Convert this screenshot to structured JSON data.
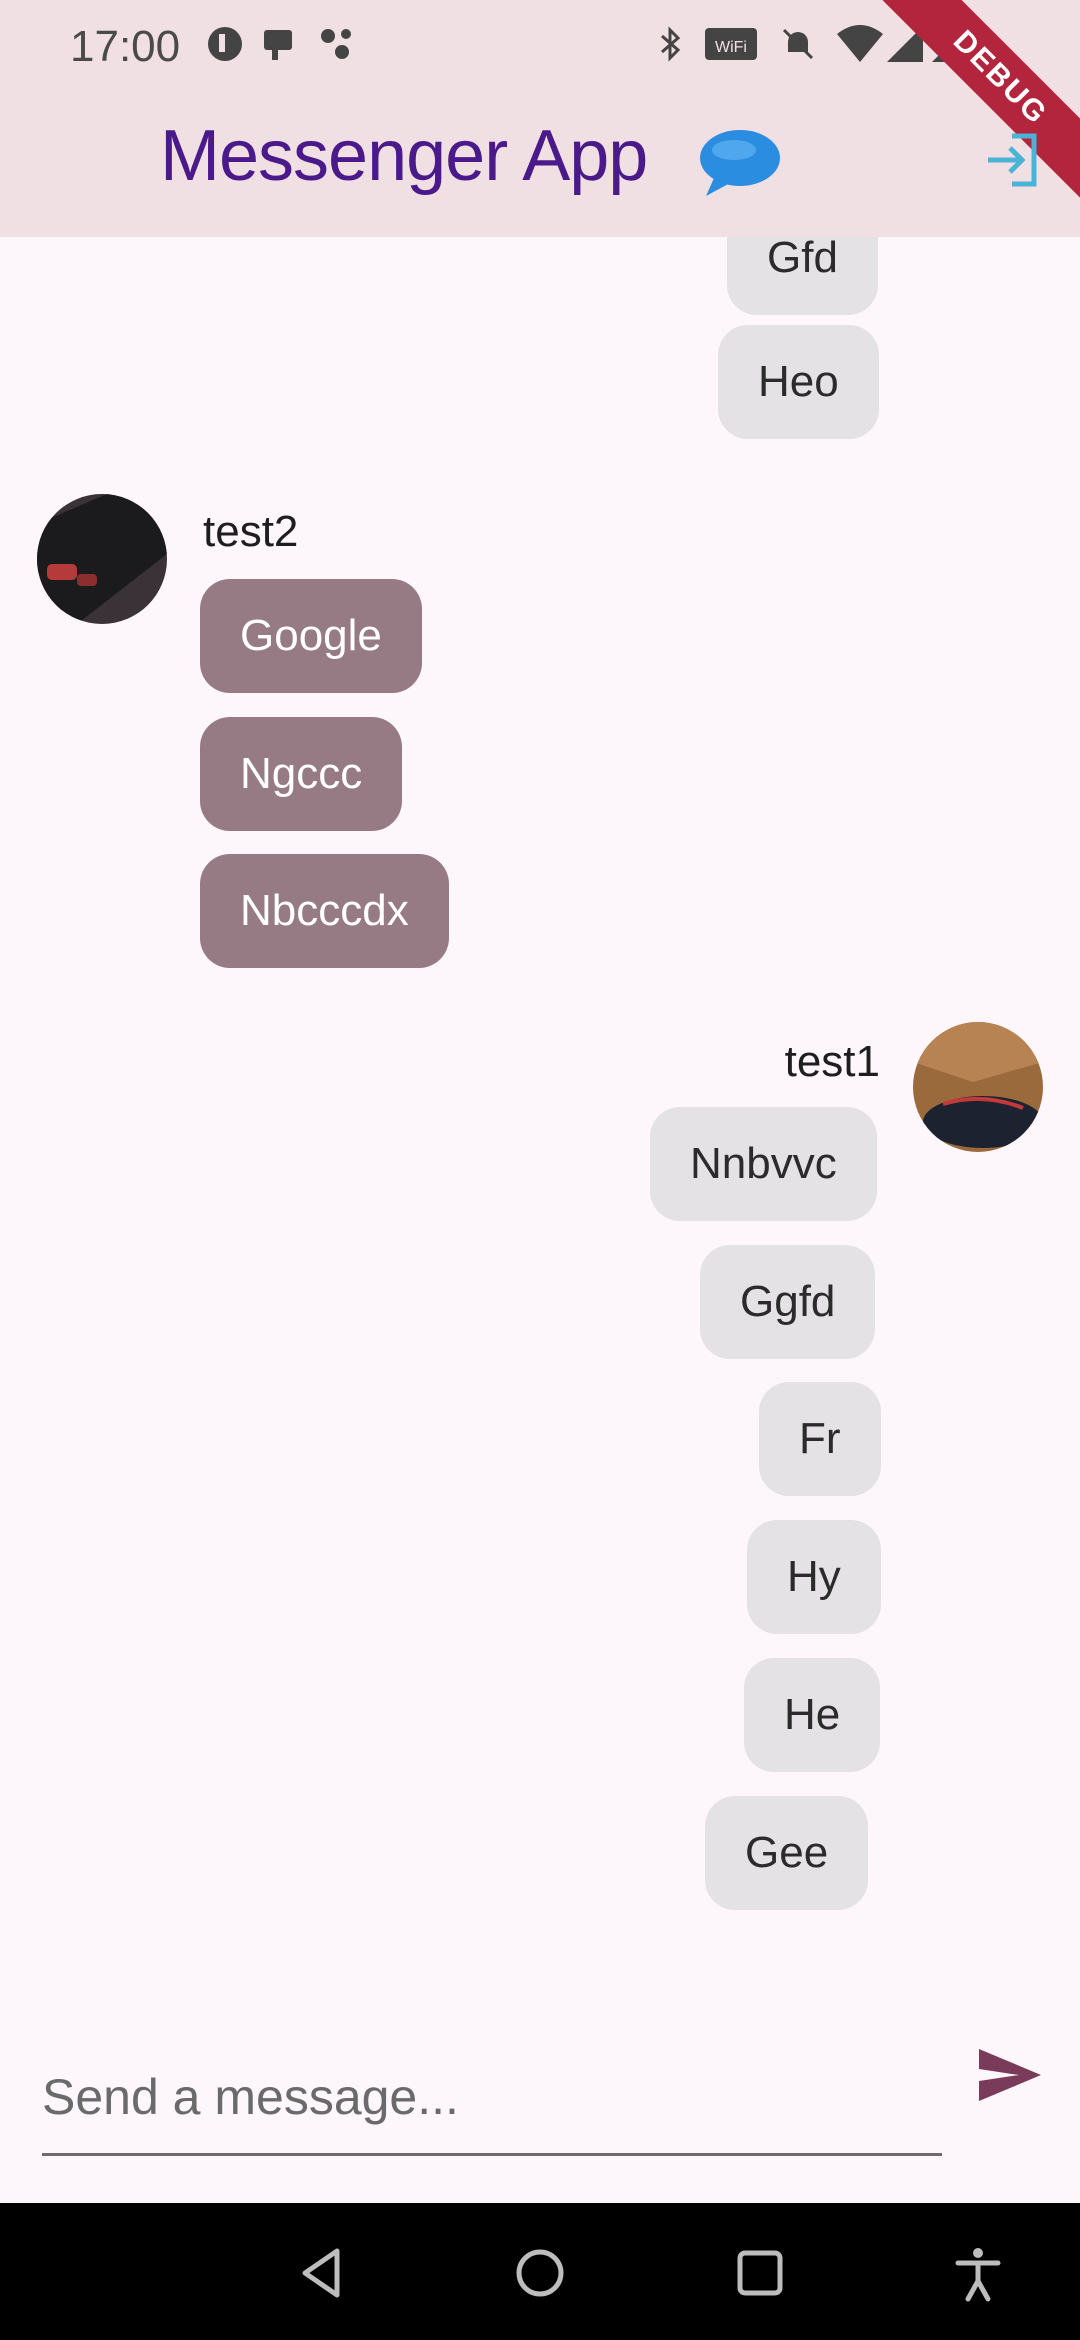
{
  "status_bar": {
    "time": "17:00"
  },
  "app_bar": {
    "title": "Messenger App",
    "ribbon": "DEBUG"
  },
  "messages_top": [
    "Gfd",
    "Heo"
  ],
  "group_test2": {
    "sender": "test2",
    "messages": [
      "Google",
      "Ngccc",
      "Nbcccdx"
    ]
  },
  "group_test1": {
    "sender": "test1",
    "messages": [
      "Nnbvvc",
      "Ggfd",
      "Fr",
      "Hy",
      "He",
      "Gee"
    ]
  },
  "composer": {
    "placeholder": "Send a message..."
  },
  "colors": {
    "app_bar": "#f1e0e3",
    "title": "#4a1a8a",
    "my_bubble": "#e4e2e4",
    "their_bubble": "#977b84",
    "accent": "#7a3a5a",
    "logout_icon": "#4ab4d6"
  },
  "icons": {
    "logout": "logout-icon",
    "send": "send-icon",
    "emoji": "speech-bubble-emoji"
  }
}
